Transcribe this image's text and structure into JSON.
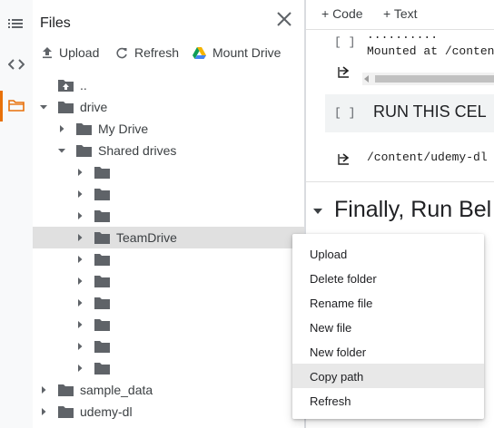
{
  "panel": {
    "title": "Files"
  },
  "toolbar": {
    "upload": "Upload",
    "refresh": "Refresh",
    "mount_drive": "Mount Drive"
  },
  "tree": {
    "parent": "..",
    "drive": "drive",
    "my_drive": "My Drive",
    "shared_drives": "Shared drives",
    "team_drive": "TeamDrive",
    "sample_data": "sample_data",
    "udemy_dl": "udemy-dl"
  },
  "notebook": {
    "add_code": "+ Code",
    "add_text": "+ Text",
    "cell_bracket": "[ ]",
    "dots": "..........",
    "output_mounted": "Mounted at /conten",
    "md_text": "RUN THIS CEL",
    "output_path": "/content/udemy-dl",
    "heading": "Finally, Run Bel"
  },
  "context_menu": {
    "items": [
      "Upload",
      "Delete folder",
      "Rename file",
      "New file",
      "New folder",
      "Copy path",
      "Refresh"
    ],
    "highlighted": "Copy path"
  },
  "colors": {
    "accent": "#e8710a",
    "folder": "#5f6368",
    "drive_blue": "#4285f4",
    "drive_green": "#0f9d58",
    "drive_yellow": "#f4b400"
  }
}
